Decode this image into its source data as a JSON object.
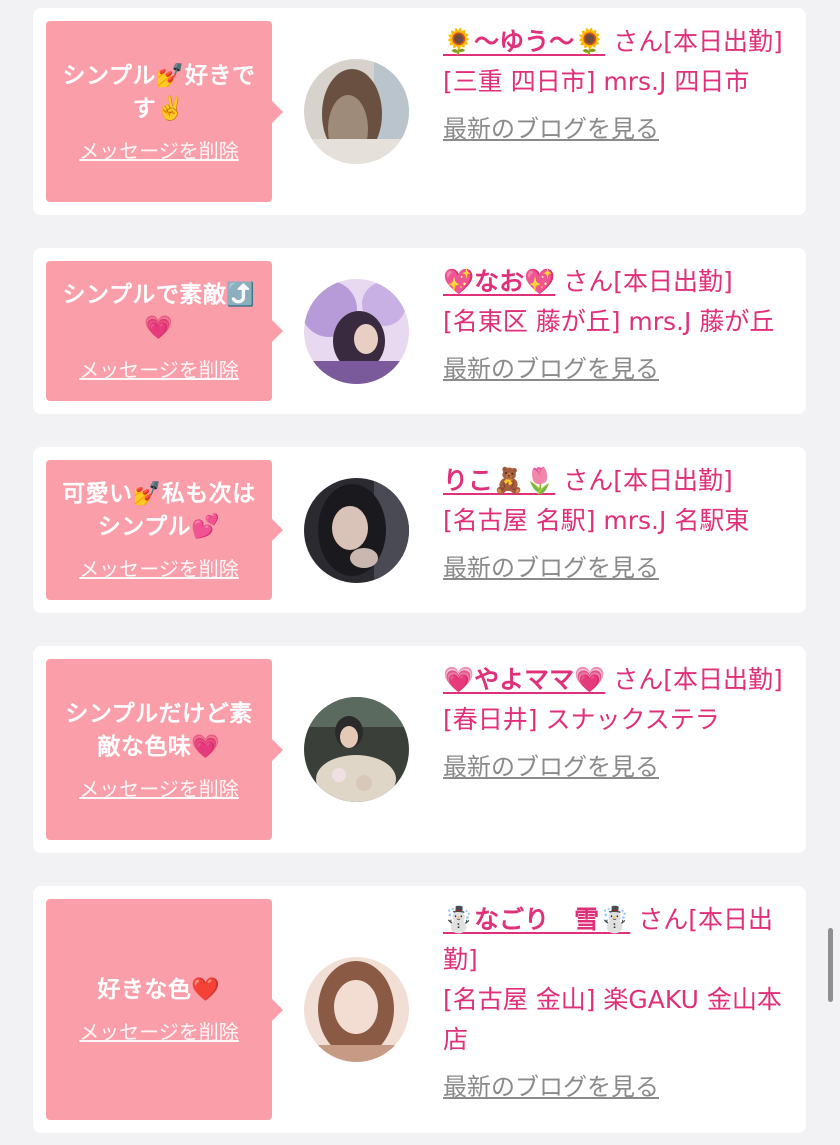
{
  "delete_label": "メッセージを削除",
  "blog_label": "最新のブログを見る",
  "san_label": "さん[本日出勤]",
  "messages": [
    {
      "message": "シンプル💅好きです✌️",
      "name": "🌻〜ゆう〜🌻",
      "shop": "[三重 四日市] mrs.J 四日市",
      "avatar_palette": [
        "#9f8b7a",
        "#4a3a30",
        "#d8d2cc"
      ]
    },
    {
      "message": "シンプルで素敵⤴️💗",
      "name": "💖なお💖",
      "shop": "[名東区 藤が丘] mrs.J 藤が丘",
      "avatar_palette": [
        "#b79bd8",
        "#5a3a6e",
        "#e8d8f0"
      ]
    },
    {
      "message": "可愛い💅私も次はシンプル💕",
      "name": "りこ🧸🌷",
      "shop": "[名古屋 名駅] mrs.J 名駅東",
      "avatar_palette": [
        "#4a4a55",
        "#1e1e24",
        "#c9b7b0"
      ]
    },
    {
      "message": "シンプルだけど素敵な色味💗",
      "name": "💗やよママ💗",
      "shop": "[春日井] スナックステラ",
      "avatar_palette": [
        "#5b6a5e",
        "#2a2a2a",
        "#e0d6c8"
      ]
    },
    {
      "message": "好きな色❤️",
      "name": "☃️なごり　雪☃️",
      "shop": "[名古屋 金山] 楽GAKU 金山本店",
      "avatar_palette": [
        "#c79a86",
        "#6a4a3a",
        "#f1dfd6"
      ]
    }
  ]
}
